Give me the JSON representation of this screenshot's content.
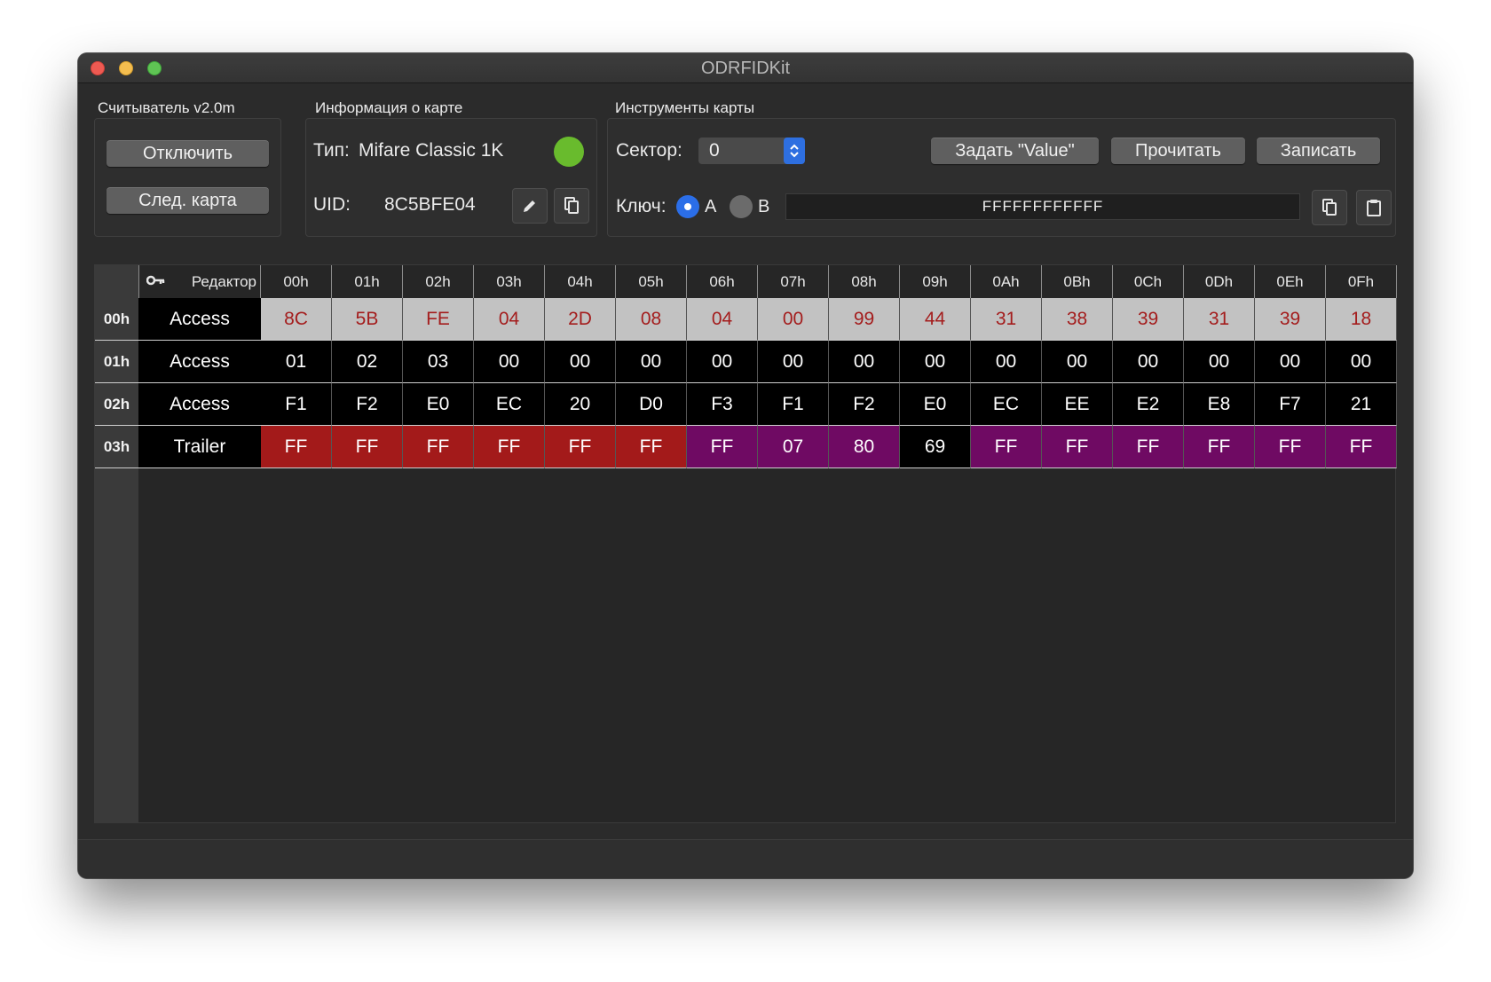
{
  "window": {
    "title": "ODRFIDKit"
  },
  "reader": {
    "group_title": "Считыватель v2.0m",
    "disconnect_label": "Отключить",
    "next_card_label": "След. карта"
  },
  "card_info": {
    "group_title": "Информация о карте",
    "type_label": "Тип:",
    "type_value": "Mifare Classic 1K",
    "status_color": "#69bb2d",
    "uid_label": "UID:",
    "uid_value": "8C5BFE04"
  },
  "tools": {
    "group_title": "Инструменты карты",
    "sector_label": "Сектор:",
    "sector_value": "0",
    "set_value_label": "Задать \"Value\"",
    "read_label": "Прочитать",
    "write_label": "Записать",
    "key_label": "Ключ:",
    "key_a_label": "A",
    "key_b_label": "B",
    "key_selected": "A",
    "key_value": "FFFFFFFFFFFF"
  },
  "editor": {
    "editor_label": "Редактор",
    "columns": [
      "00h",
      "01h",
      "02h",
      "03h",
      "04h",
      "05h",
      "06h",
      "07h",
      "08h",
      "09h",
      "0Ah",
      "0Bh",
      "0Ch",
      "0Dh",
      "0Eh",
      "0Fh"
    ],
    "colors": {
      "uid_bg": "#c2c2c2",
      "uid_fg": "#a41d1d",
      "data_bg": "#000000",
      "data_fg": "#ffffff",
      "keyA_bg": "#a31a1a",
      "access_bg": "#6f0a63",
      "fg_light": "#ffffff"
    },
    "rows": [
      {
        "label": "00h",
        "name": "Access",
        "cells": [
          "8C",
          "5B",
          "FE",
          "04",
          "2D",
          "08",
          "04",
          "00",
          "99",
          "44",
          "31",
          "38",
          "39",
          "31",
          "39",
          "18"
        ],
        "styles": [
          "u",
          "u",
          "u",
          "u",
          "u",
          "u",
          "u",
          "u",
          "u",
          "u",
          "u",
          "u",
          "u",
          "u",
          "u",
          "u"
        ]
      },
      {
        "label": "01h",
        "name": "Access",
        "cells": [
          "01",
          "02",
          "03",
          "00",
          "00",
          "00",
          "00",
          "00",
          "00",
          "00",
          "00",
          "00",
          "00",
          "00",
          "00",
          "00"
        ],
        "styles": [
          "d",
          "d",
          "d",
          "d",
          "d",
          "d",
          "d",
          "d",
          "d",
          "d",
          "d",
          "d",
          "d",
          "d",
          "d",
          "d"
        ]
      },
      {
        "label": "02h",
        "name": "Access",
        "cells": [
          "F1",
          "F2",
          "E0",
          "EC",
          "20",
          "D0",
          "F3",
          "F1",
          "F2",
          "E0",
          "EC",
          "EE",
          "E2",
          "E8",
          "F7",
          "21"
        ],
        "styles": [
          "d",
          "d",
          "d",
          "d",
          "d",
          "d",
          "d",
          "d",
          "d",
          "d",
          "d",
          "d",
          "d",
          "d",
          "d",
          "d"
        ]
      },
      {
        "label": "03h",
        "name": "Trailer",
        "cells": [
          "FF",
          "FF",
          "FF",
          "FF",
          "FF",
          "FF",
          "FF",
          "07",
          "80",
          "69",
          "FF",
          "FF",
          "FF",
          "FF",
          "FF",
          "FF"
        ],
        "styles": [
          "a",
          "a",
          "a",
          "a",
          "a",
          "a",
          "p",
          "p",
          "p",
          "d",
          "p",
          "p",
          "p",
          "p",
          "p",
          "p"
        ]
      }
    ]
  }
}
